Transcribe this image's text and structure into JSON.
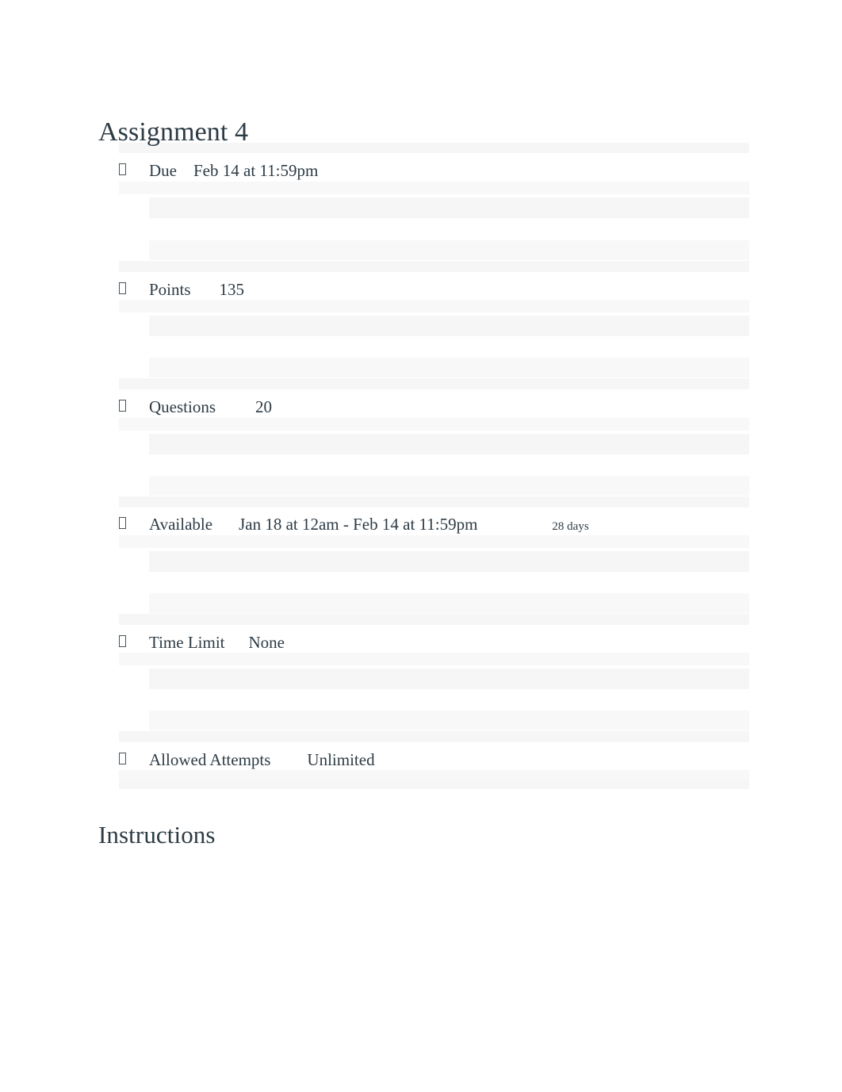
{
  "page": {
    "title": "Assignment 4",
    "instructions_heading": "Instructions",
    "text_color": "#2d3b45",
    "band_color": "#f6f6f7",
    "background": "#ffffff"
  },
  "details": {
    "bullet_glyph": "tofu-box-icon",
    "rows": [
      {
        "label": "Due",
        "value": "Feb 14 at 11:59pm",
        "sub": ""
      },
      {
        "label": "Points",
        "value": "135",
        "sub": ""
      },
      {
        "label": "Questions",
        "value": "20",
        "sub": ""
      },
      {
        "label": "Available",
        "value": "Jan 18 at 12am - Feb 14 at 11:59pm",
        "sub": "28 days"
      },
      {
        "label": "Time Limit",
        "value": "None",
        "sub": ""
      },
      {
        "label": "Allowed Attempts",
        "value": "Unlimited",
        "sub": ""
      }
    ]
  }
}
